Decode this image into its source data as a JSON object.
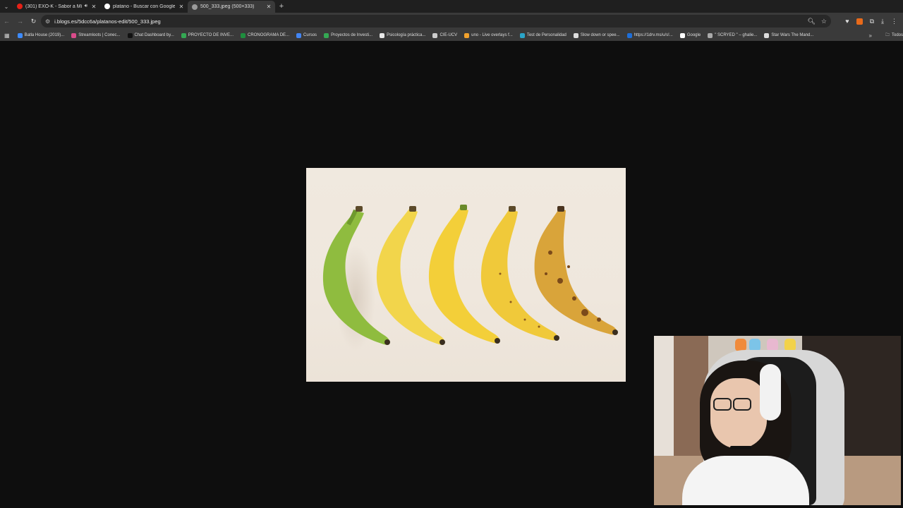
{
  "browser": {
    "tabs": [
      {
        "title": "(301) EXO-K - Sabor a Mí (M...",
        "favicon_color": "#e62117",
        "favicon": "youtube-icon",
        "has_audio": true,
        "active": false
      },
      {
        "title": "platano - Buscar con Google",
        "favicon_color": "#ffffff",
        "favicon": "google-icon",
        "has_audio": false,
        "active": false
      },
      {
        "title": "500_333.jpeg (500×333)",
        "favicon_color": "#9a9a9a",
        "favicon": "globe-icon",
        "has_audio": false,
        "active": true
      }
    ],
    "url": "i.blogs.es/5dcc6a/platanos-edit/500_333.jpeg",
    "bookmarks": [
      {
        "label": "Batla House (2019)...",
        "icon_color": "#3d8bfd"
      },
      {
        "label": "Streamloots | Conec...",
        "icon_color": "#d94b8a"
      },
      {
        "label": "Chat Dashboard by...",
        "icon_color": "#111111"
      },
      {
        "label": "PROYECTO DE INVE...",
        "icon_color": "#34a853"
      },
      {
        "label": "CRONOGRAMA DE...",
        "icon_color": "#1e8e3e"
      },
      {
        "label": "Cursos",
        "icon_color": "#4285f4"
      },
      {
        "label": "Proyectos de Investi...",
        "icon_color": "#34a853"
      },
      {
        "label": "Psicología práctica...",
        "icon_color": "#e8e8e8"
      },
      {
        "label": "CIE-UCV",
        "icon_color": "#cccccc"
      },
      {
        "label": "uno - Live overlays f...",
        "icon_color": "#f2a22c"
      },
      {
        "label": "Test de Personalidad",
        "icon_color": "#2aa5c9"
      },
      {
        "label": "Slow down or spee...",
        "icon_color": "#dddddd"
      },
      {
        "label": "https://1drv.ms/u/s!...",
        "icon_color": "#1e6fd9"
      },
      {
        "label": "Google",
        "icon_color": "#ffffff"
      },
      {
        "label": "\" SCRYED \" – ghalie...",
        "icon_color": "#aaaaaa"
      },
      {
        "label": "Star Wars The Mand...",
        "icon_color": "#dddddd"
      }
    ],
    "all_bookmarks_label": "Todos"
  },
  "image": {
    "description_colors": [
      "#8fbc3f",
      "#f2d54b",
      "#f3cf39",
      "#f0c93a",
      "#d9a43a"
    ]
  }
}
